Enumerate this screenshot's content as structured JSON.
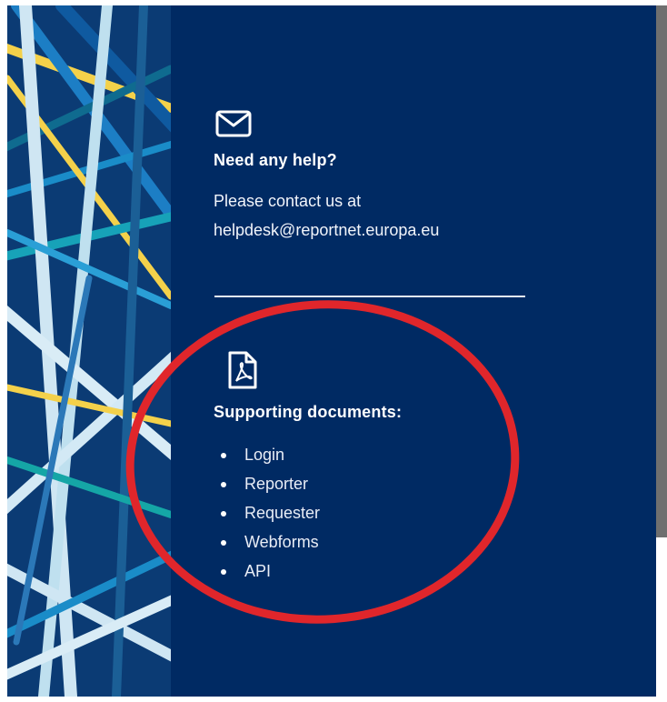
{
  "help": {
    "icon": "envelope-icon",
    "title": "Need any help?",
    "line1": "Please contact us at",
    "email": "helpdesk@reportnet.europa.eu"
  },
  "docs": {
    "icon": "pdf-file-icon",
    "title": "Supporting documents:",
    "items": [
      "Login",
      "Reporter",
      "Requester",
      "Webforms",
      "API"
    ]
  },
  "colors": {
    "panel_bg": "#002a63",
    "annotation": "#e0262b",
    "text": "#ffffff"
  }
}
